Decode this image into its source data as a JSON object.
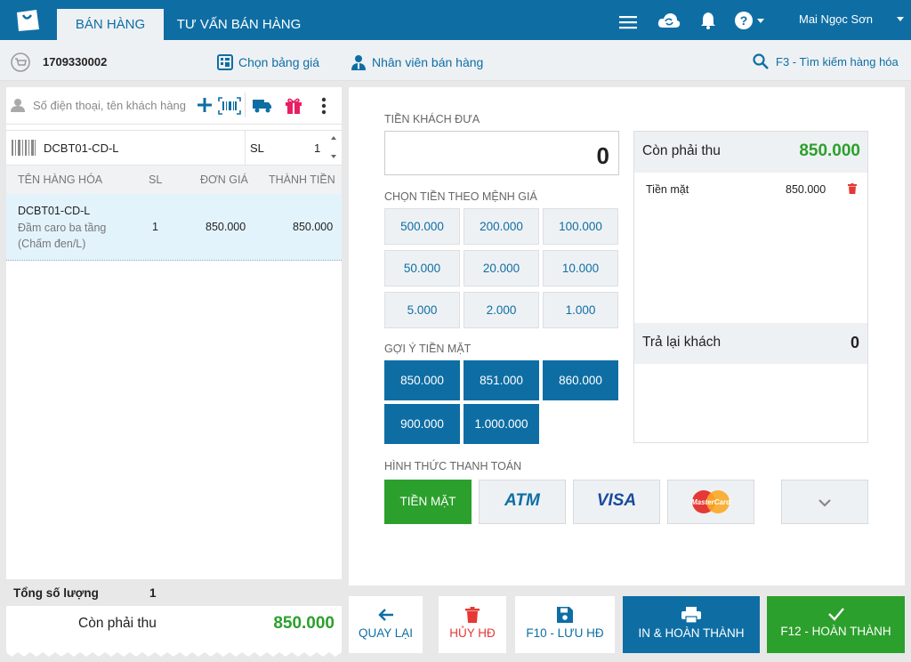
{
  "header": {
    "tabs": [
      {
        "label": "BÁN HÀNG"
      },
      {
        "label": "TƯ VẤN BÁN HÀNG"
      }
    ],
    "user_name": "Mai Ngọc Sơn",
    "icons": [
      "menu-icon",
      "cloud-sync-icon",
      "bell-icon",
      "help-icon"
    ]
  },
  "subbar": {
    "order_id": "1709330002",
    "price_list_label": "Chọn bảng giá",
    "staff_label": "Nhân viên bán hàng",
    "search_label": "F3 - Tìm kiếm hàng hóa"
  },
  "customer": {
    "placeholder": "Số điện thoại, tên khách hàng"
  },
  "item_input": {
    "code": "DCBT01-CD-L",
    "qty_label": "SL",
    "qty": "1"
  },
  "table": {
    "headers": {
      "name": "TÊN HÀNG HÓA",
      "qty": "SL",
      "unit_price": "ĐƠN GIÁ",
      "total": "THÀNH TIỀN"
    },
    "rows": [
      {
        "code": "DCBT01-CD-L",
        "name": "Đầm caro ba tầng",
        "variant": "(Chấm đen/L)",
        "qty": "1",
        "unit_price": "850.000",
        "total": "850.000"
      }
    ]
  },
  "summary": {
    "total_qty_label": "Tổng số lượng",
    "total_qty": "1",
    "remaining_label": "Còn phải thu",
    "remaining": "850.000"
  },
  "payment": {
    "cash_given_label": "TIỀN KHÁCH ĐƯA",
    "cash_given": "0",
    "denom_label": "CHỌN TIỀN THEO MỆNH GIÁ",
    "denominations": [
      "500.000",
      "200.000",
      "100.000",
      "50.000",
      "20.000",
      "10.000",
      "5.000",
      "2.000",
      "1.000"
    ],
    "suggest_label": "GỢI Ý TIỀN MẶT",
    "suggestions": [
      "850.000",
      "851.000",
      "860.000",
      "900.000",
      "1.000.000"
    ],
    "remaining_label": "Còn phải thu",
    "remaining": "850.000",
    "lines": [
      {
        "method": "Tiền mặt",
        "amount": "850.000"
      }
    ],
    "change_label": "Trả lại khách",
    "change": "0",
    "methods_label": "HÌNH THỨC THANH TOÁN",
    "methods": [
      "TIỀN MẶT",
      "ATM",
      "VISA",
      "MasterCard"
    ]
  },
  "actions": {
    "back": "QUAY LẠI",
    "cancel": "HỦY HĐ",
    "save": "F10 - LƯU HĐ",
    "print_complete": "IN & HOÀN THÀNH",
    "complete": "F12 - HOÀN THÀNH"
  },
  "colors": {
    "primary": "#0e6ea4",
    "success": "#2ca02c",
    "danger": "#e53935",
    "gift": "#e91e63"
  }
}
